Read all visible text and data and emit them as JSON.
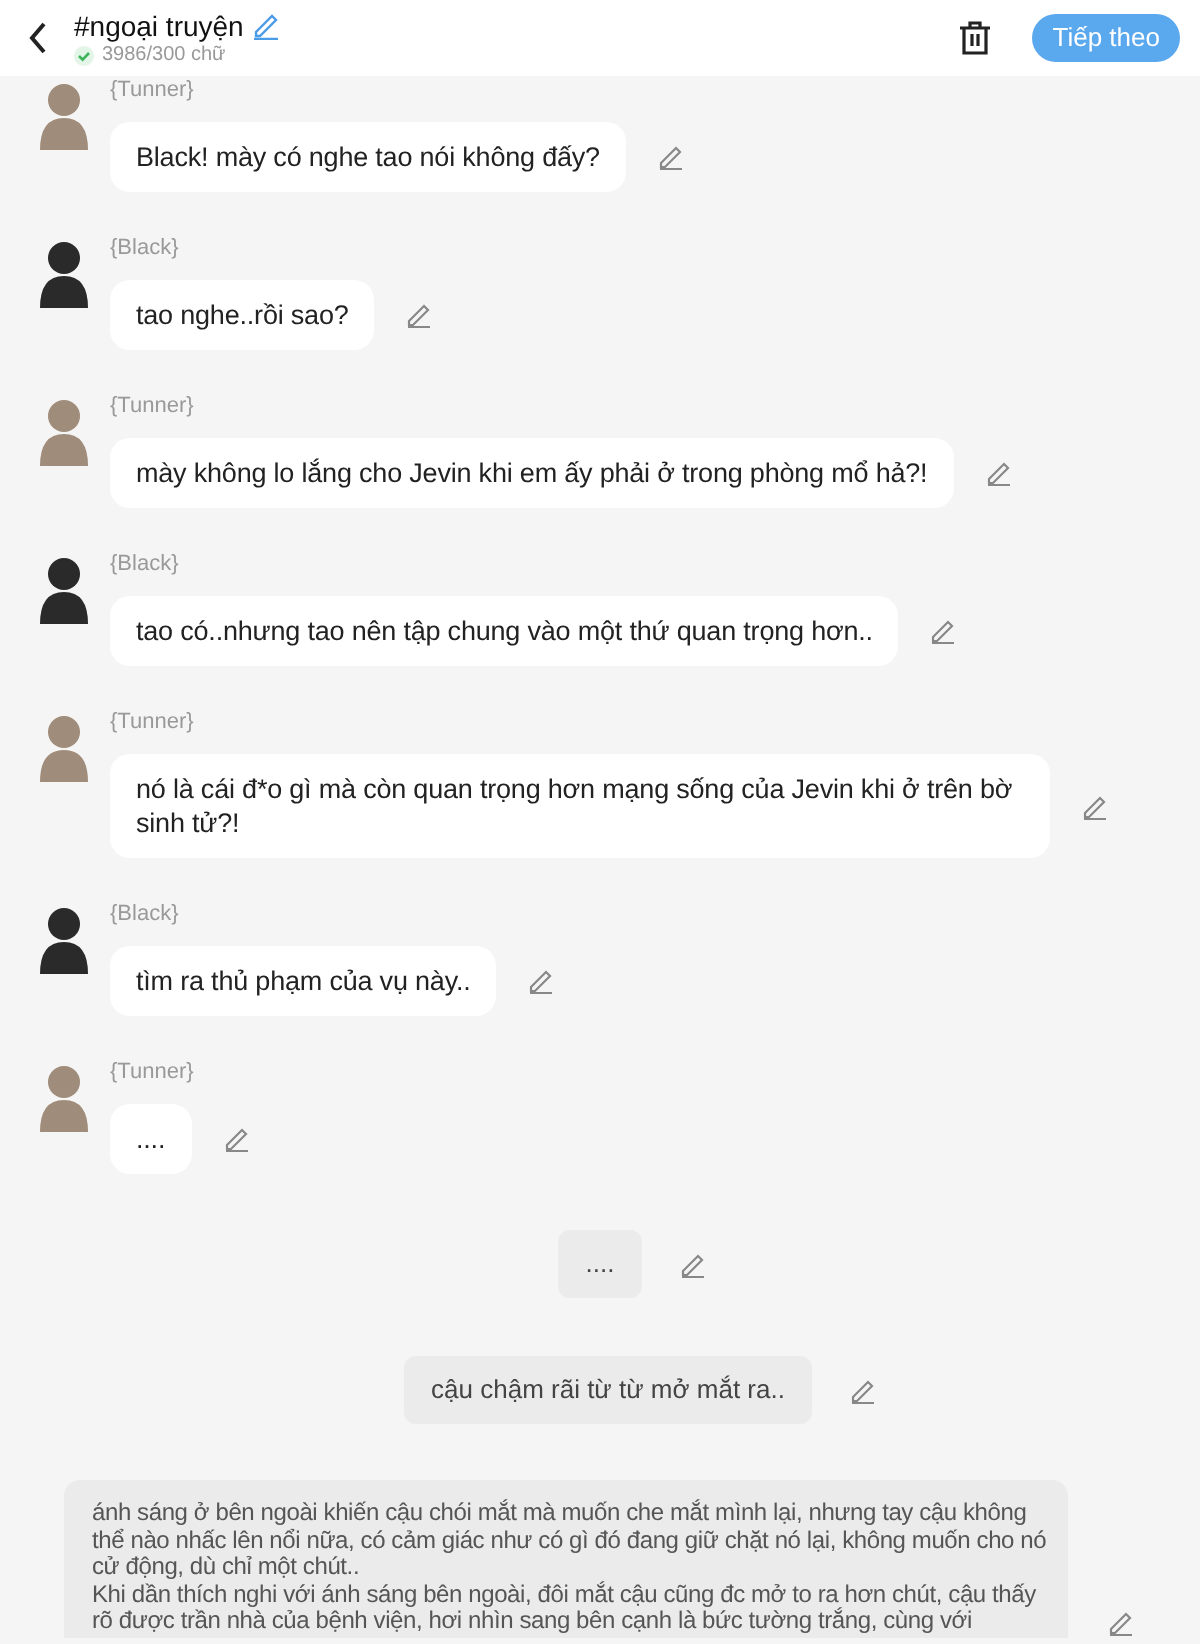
{
  "header": {
    "title": "#ngoại truyện",
    "word_count": "3986/300 chữ",
    "next_button": "Tiếp theo"
  },
  "messages": [
    {
      "kind": "character",
      "speaker": "{Tunner}",
      "color": "#a08c7a",
      "text": "Black! mày có nghe tao nói không đấy?"
    },
    {
      "kind": "character",
      "speaker": "{Black}",
      "color": "#2a2a2a",
      "text": "tao nghe..rồi sao?"
    },
    {
      "kind": "character",
      "speaker": "{Tunner}",
      "color": "#a08c7a",
      "text": "mày không lo lắng cho Jevin khi em ấy phải ở trong phòng mổ hả?!"
    },
    {
      "kind": "character",
      "speaker": "{Black}",
      "color": "#2a2a2a",
      "text": "tao có..nhưng tao nên tập chung vào một thứ quan trọng hơn.."
    },
    {
      "kind": "character",
      "speaker": "{Tunner}",
      "color": "#a08c7a",
      "text": "nó là cái đ*o gì mà còn quan trọng hơn mạng sống của Jevin khi ở trên bờ sinh tử?!"
    },
    {
      "kind": "character",
      "speaker": "{Black}",
      "color": "#2a2a2a",
      "text": "tìm ra thủ phạm của vụ này.."
    },
    {
      "kind": "character",
      "speaker": "{Tunner}",
      "color": "#a08c7a",
      "text": "...."
    },
    {
      "kind": "narration",
      "text": "...."
    },
    {
      "kind": "narration",
      "text": "cậu chậm rãi từ từ mở mắt ra.."
    },
    {
      "kind": "paragraph",
      "text": "ánh sáng ở bên ngoài khiến cậu chói mắt mà muốn che mắt mình lại, nhưng tay cậu không thể nào nhấc lên nổi nữa, có cảm giác như có gì đó đang giữ chặt nó lại, không muốn cho nó cử động, dù chỉ một chút..\nKhi dần thích nghi với ánh sáng bên ngoài, đôi mắt cậu cũng đc mở to ra hơn chút, cậu thấy rõ được trần nhà của bệnh viện, hơi nhìn sang bên cạnh là bức tường trắng, cùng với"
    }
  ]
}
